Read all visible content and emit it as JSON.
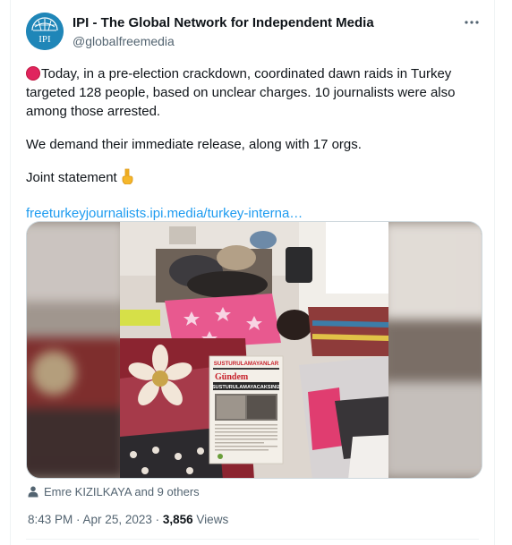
{
  "author": {
    "name": "IPI - The Global Network for Independent Media",
    "handle": "@globalfreemedia",
    "avatar_text": "IPI"
  },
  "tweet": {
    "paragraph1": "Today, in a pre-election crackdown, coordinated dawn raids in Turkey targeted 128 people, based on unclear charges. 10 journalists were also among those arrested.",
    "paragraph2": "We demand their immediate release, along with 17 orgs.",
    "paragraph3": "Joint statement",
    "link": "freeturkeyjournalists.ipi.media/turkey-interna…"
  },
  "media": {
    "newspaper_masthead": "SUSTURULAMAYANLAR",
    "newspaper_section": "Gündem",
    "newspaper_headline": "SUSTURULAMAYACAKSINIZ"
  },
  "tagged": {
    "text": "Emre KIZILKAYA and 9 others"
  },
  "meta": {
    "time": "8:43 PM",
    "separator": " · ",
    "date": "Apr 25, 2023",
    "views_count": "3,856",
    "views_label": "Views"
  },
  "icons": {
    "more": "more-dots-icon",
    "person": "person-icon",
    "red_circle": "red-circle-emoji",
    "point_down": "backhand-point-down-emoji"
  },
  "colors": {
    "link": "#1d9bf0",
    "secondary_text": "#536471",
    "avatar_bg": "#1c7fb0"
  }
}
